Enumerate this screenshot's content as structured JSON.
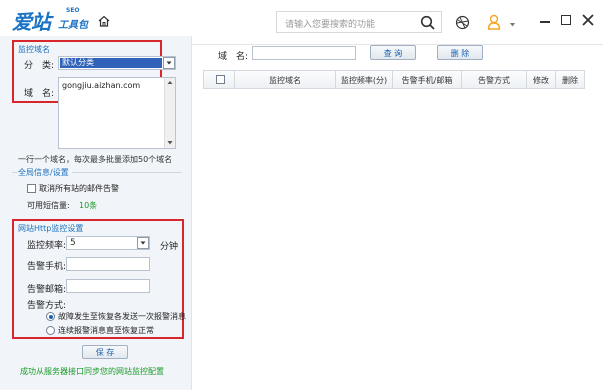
{
  "app": {
    "logo_main": "爱站",
    "logo_sub": "工具包",
    "logo_seo": "SEO"
  },
  "topbar": {
    "search_placeholder": "请输入您要搜索的功能"
  },
  "monitor_domain": {
    "title": "监控域名",
    "category_label": "分　类:",
    "category_value": "默认分类",
    "domain_label": "域　名:",
    "domain_value": "gongjiu.aizhan.com",
    "hint": "一行一个域名，每次最多批量添加50个域名"
  },
  "global_settings": {
    "title": "全局信息/设置",
    "cancel_alert_label": "取消所有站的邮件告警",
    "quota_label": "可用短信量:",
    "quota_value": "10条"
  },
  "http_monitor": {
    "title": "网站Http监控设置",
    "frequency_label": "监控频率:",
    "frequency_value": "5",
    "frequency_unit": "分钟",
    "phone_label": "告警手机:",
    "email_label": "告警邮箱:",
    "method_label": "告警方式:",
    "options": [
      "故障发生至恢复各发送一次报警消息",
      "连续报警消息直至恢复正常"
    ],
    "save_label": "保 存",
    "sync_status": "成功从服务器接口同步您的网站监控配置"
  },
  "filter": {
    "domain_label": "域　名:",
    "query_label": "查 询",
    "delete_label": "删 除"
  },
  "table": {
    "columns": [
      "监控域名",
      "监控频率(分)",
      "告警手机/邮箱",
      "告警方式",
      "修改",
      "删除"
    ]
  }
}
